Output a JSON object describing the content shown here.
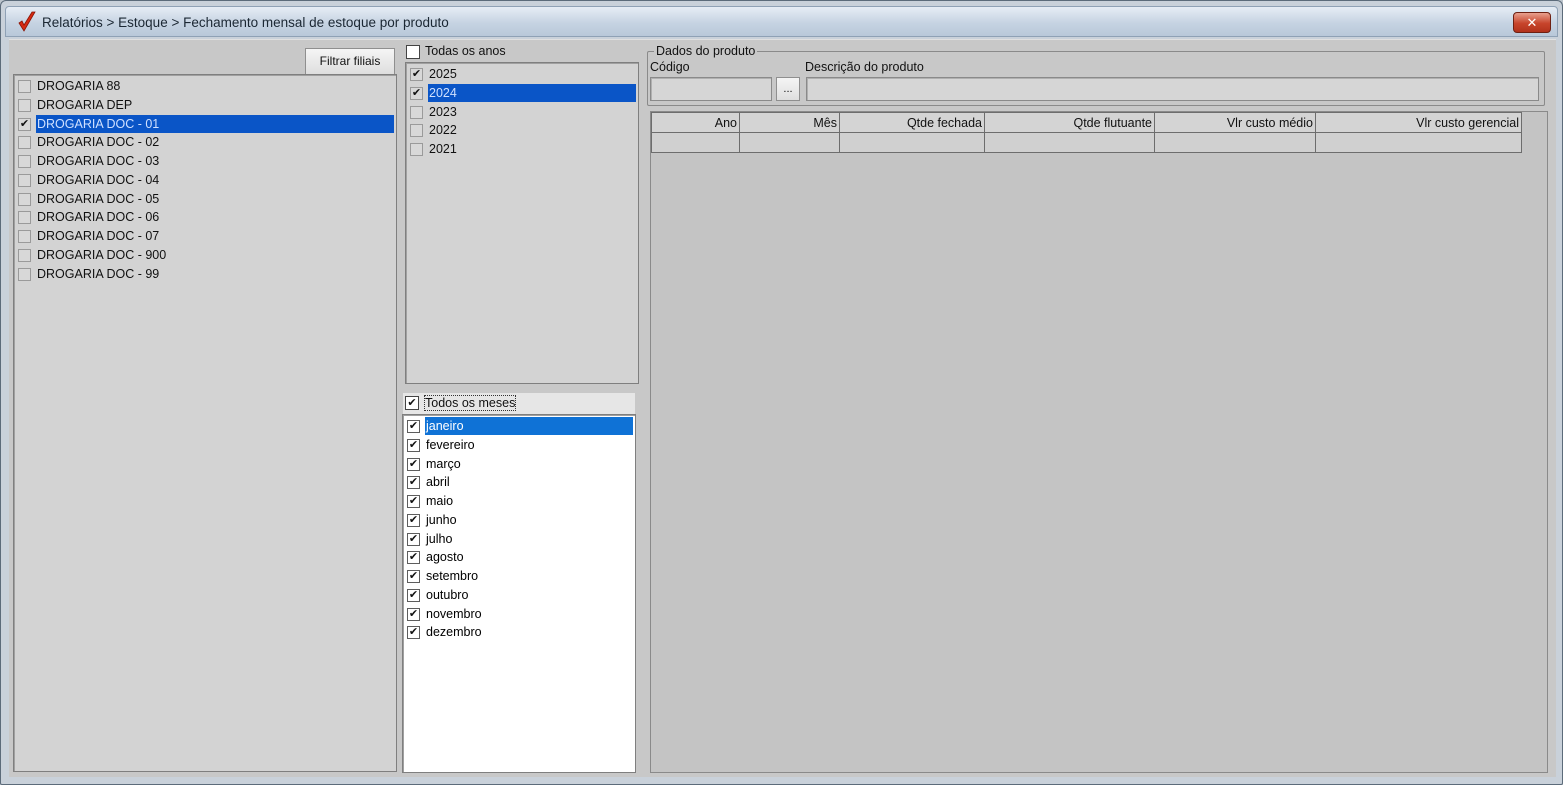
{
  "window": {
    "title": "Relatórios > Estoque > Fechamento mensal de estoque por produto",
    "close_glyph": "✕",
    "app_icon": "red-checkmark-icon",
    "accent_color": "#0a55c7"
  },
  "branches": {
    "filter_button_label": "Filtrar filiais",
    "items": [
      {
        "label": "DROGARIA 88",
        "checked": false,
        "selected": false
      },
      {
        "label": "DROGARIA DEP",
        "checked": false,
        "selected": false
      },
      {
        "label": "DROGARIA DOC - 01",
        "checked": true,
        "selected": true
      },
      {
        "label": "DROGARIA DOC - 02",
        "checked": false,
        "selected": false
      },
      {
        "label": "DROGARIA DOC - 03",
        "checked": false,
        "selected": false
      },
      {
        "label": "DROGARIA DOC - 04",
        "checked": false,
        "selected": false
      },
      {
        "label": "DROGARIA DOC - 05",
        "checked": false,
        "selected": false
      },
      {
        "label": "DROGARIA DOC - 06",
        "checked": false,
        "selected": false
      },
      {
        "label": "DROGARIA DOC - 07",
        "checked": false,
        "selected": false
      },
      {
        "label": "DROGARIA DOC - 900",
        "checked": false,
        "selected": false
      },
      {
        "label": "DROGARIA DOC - 99",
        "checked": false,
        "selected": false
      }
    ]
  },
  "years": {
    "all_label": "Todas os anos",
    "all_checked": false,
    "items": [
      {
        "label": "2025",
        "checked": true,
        "selected": false
      },
      {
        "label": "2024",
        "checked": true,
        "selected": true
      },
      {
        "label": "2023",
        "checked": false,
        "selected": false
      },
      {
        "label": "2022",
        "checked": false,
        "selected": false
      },
      {
        "label": "2021",
        "checked": false,
        "selected": false
      }
    ]
  },
  "months": {
    "all_label": "Todos os meses",
    "all_checked": true,
    "items": [
      {
        "label": "janeiro",
        "checked": true,
        "selected": true
      },
      {
        "label": "fevereiro",
        "checked": true,
        "selected": false
      },
      {
        "label": "março",
        "checked": true,
        "selected": false
      },
      {
        "label": "abril",
        "checked": true,
        "selected": false
      },
      {
        "label": "maio",
        "checked": true,
        "selected": false
      },
      {
        "label": "junho",
        "checked": true,
        "selected": false
      },
      {
        "label": "julho",
        "checked": true,
        "selected": false
      },
      {
        "label": "agosto",
        "checked": true,
        "selected": false
      },
      {
        "label": "setembro",
        "checked": true,
        "selected": false
      },
      {
        "label": "outubro",
        "checked": true,
        "selected": false
      },
      {
        "label": "novembro",
        "checked": true,
        "selected": false
      },
      {
        "label": "dezembro",
        "checked": true,
        "selected": false
      }
    ]
  },
  "product": {
    "group_title": "Dados do produto",
    "code_label": "Código",
    "code_value": "",
    "lookup_button_label": "...",
    "description_label": "Descrição do produto",
    "description_value": ""
  },
  "grid": {
    "columns": [
      "Ano",
      "Mês",
      "Qtde fechada",
      "Qtde flutuante",
      "Vlr custo médio",
      "Vlr custo gerencial"
    ],
    "rows": [
      [
        "",
        "",
        "",
        "",
        "",
        ""
      ]
    ]
  }
}
